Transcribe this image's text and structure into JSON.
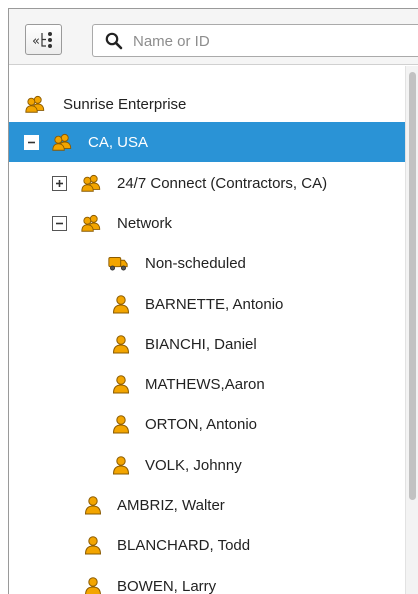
{
  "toolbar": {
    "collapse_icon": "collapse-tree-icon",
    "search_placeholder": "Name or ID",
    "search_value": ""
  },
  "tree": {
    "root": {
      "label": "Sunrise Enterprise",
      "icon": "group-icon"
    },
    "selected": {
      "label": "CA, USA",
      "icon": "group-icon",
      "expanded": true
    },
    "group_247": {
      "label": "24/7 Connect (Contractors, CA)",
      "icon": "group-icon",
      "expanded": false
    },
    "network": {
      "label": "Network",
      "icon": "group-icon",
      "expanded": true
    },
    "network_children": [
      {
        "label": "Non-scheduled",
        "icon": "vehicle-icon"
      },
      {
        "label": "BARNETTE, Antonio",
        "icon": "user-icon"
      },
      {
        "label": "BIANCHI, Daniel",
        "icon": "user-icon"
      },
      {
        "label": "MATHEWS,Aaron",
        "icon": "user-icon"
      },
      {
        "label": "ORTON, Antonio",
        "icon": "user-icon"
      },
      {
        "label": "VOLK, Johnny",
        "icon": "user-icon"
      }
    ],
    "ca_users": [
      {
        "label": "AMBRIZ, Walter",
        "icon": "user-icon"
      },
      {
        "label": "BLANCHARD, Todd",
        "icon": "user-icon"
      },
      {
        "label": "BOWEN, Larry",
        "icon": "user-icon"
      }
    ]
  },
  "colors": {
    "selection": "#2a93d6",
    "icon_orange": "#f0a000"
  }
}
